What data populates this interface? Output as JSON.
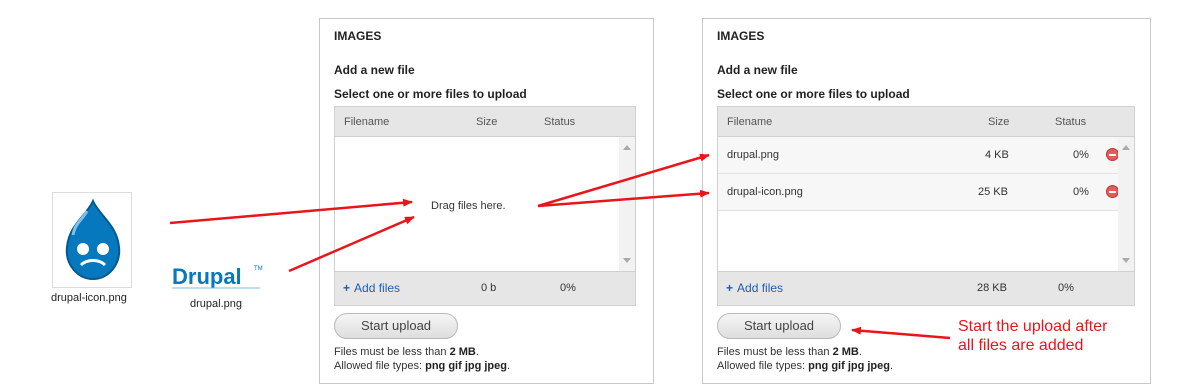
{
  "source_files": [
    {
      "name": "drupal-icon.png"
    },
    {
      "name": "drupal.png",
      "logo_text": "Drupal",
      "logo_mark": "TM"
    }
  ],
  "panels": [
    {
      "title": "IMAGES",
      "add_new": "Add a new file",
      "select_label": "Select one or more files to upload",
      "columns": {
        "filename": "Filename",
        "size": "Size",
        "status": "Status"
      },
      "drop_text": "Drag files here.",
      "add_files": "Add files",
      "total_size": "0 b",
      "total_status": "0%",
      "start_upload": "Start upload",
      "limit_prefix": "Files must be less than ",
      "limit_value": "2 MB",
      "limit_suffix": ".",
      "types_prefix": "Allowed file types: ",
      "types_value": "png gif jpg jpeg",
      "types_suffix": "."
    },
    {
      "title": "IMAGES",
      "add_new": "Add a new file",
      "select_label": "Select one or more files to upload",
      "columns": {
        "filename": "Filename",
        "size": "Size",
        "status": "Status"
      },
      "files": [
        {
          "name": "drupal.png",
          "size": "4 KB",
          "status": "0%"
        },
        {
          "name": "drupal-icon.png",
          "size": "25 KB",
          "status": "0%"
        }
      ],
      "add_files": "Add files",
      "total_size": "28 KB",
      "total_status": "0%",
      "start_upload": "Start upload",
      "limit_prefix": "Files must be less than ",
      "limit_value": "2 MB",
      "limit_suffix": ".",
      "types_prefix": "Allowed file types: ",
      "types_value": "png gif jpg jpeg",
      "types_suffix": "."
    }
  ],
  "annotation": {
    "line1": "Start the upload after",
    "line2": "all files are added"
  },
  "colors": {
    "arrow": "#e8161b",
    "drupal_blue": "#0678be",
    "link": "#1a5fb4"
  }
}
